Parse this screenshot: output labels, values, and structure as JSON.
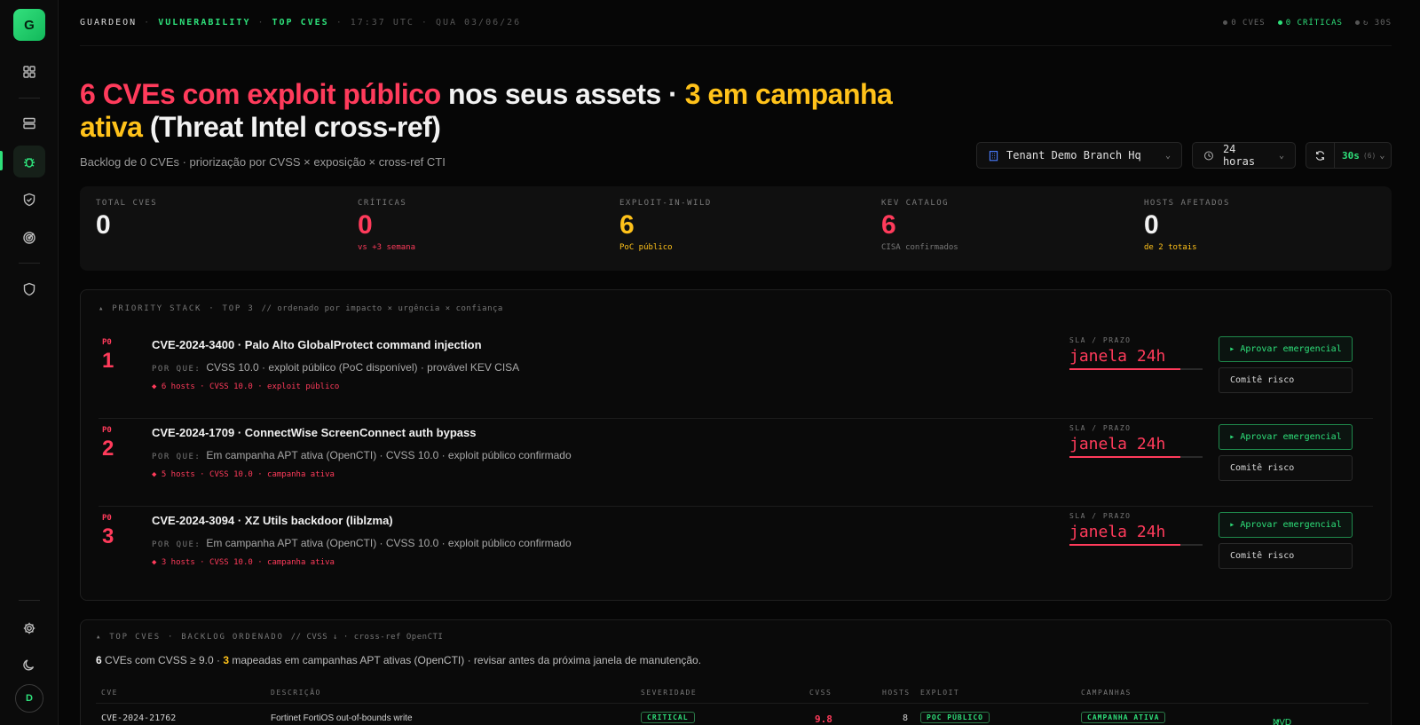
{
  "sidebar": {
    "logo": "G",
    "avatar": "D"
  },
  "topbar": {
    "crumbs": [
      "GUARDEON",
      "VULNERABILITY",
      "TOP CVES",
      "17:37 UTC",
      "QUA 03/06/26"
    ],
    "status": [
      "0 CVES",
      "0 CRÍTICAS",
      "↻ 30S"
    ]
  },
  "header": {
    "headline_red": "6 CVEs com exploit público",
    "headline_mid": " nos seus assets · ",
    "headline_amber": "3 em campanha ativa",
    "headline_end": " (Threat Intel cross-ref)",
    "subline": "Backlog de 0 CVEs · priorização por CVSS × exposição × cross-ref CTI"
  },
  "controls": {
    "tenant": "Tenant Demo Branch Hq",
    "range": "24 horas",
    "refresh": "30s",
    "refresh_count": "(6)"
  },
  "kpis": [
    {
      "label": "TOTAL CVES",
      "value": "0",
      "sub": "",
      "color": "#f2f2f2",
      "sub_color": "#777"
    },
    {
      "label": "CRÍTICAS",
      "value": "0",
      "sub": "vs +3 semana",
      "color": "#ff3b5b",
      "sub_color": "#ff3b5b"
    },
    {
      "label": "EXPLOIT-IN-WILD",
      "value": "6",
      "sub": "PoC público",
      "color": "#ffc21a",
      "sub_color": "#ffc21a"
    },
    {
      "label": "KEV CATALOG",
      "value": "6",
      "sub": "CISA confirmados",
      "color": "#ff3b5b",
      "sub_color": "#777"
    },
    {
      "label": "HOSTS AFETADOS",
      "value": "0",
      "sub": "de 2 totais",
      "color": "#f2f2f2",
      "sub_color": "#ffc21a"
    }
  ],
  "priority": {
    "head": "PRIORITY STACK",
    "top": "TOP 3",
    "comment": "// ordenado por impacto × urgência × confiança",
    "why_label": "POR QUE:",
    "sla_label": "SLA / PRAZO",
    "approve_label": "▸ Aprovar emergencial",
    "committee_label": "Comitê risco",
    "items": [
      {
        "tag": "P0",
        "num": "1",
        "title": "CVE-2024-3400 · Palo Alto GlobalProtect command injection",
        "why": "CVSS 10.0 · exploit público (PoC disponível) · provável KEV CISA",
        "meta": "◆ 6 hosts · CVSS 10.0 · exploit público",
        "sla": "janela 24h",
        "sla_fill": 0.83
      },
      {
        "tag": "P0",
        "num": "2",
        "title": "CVE-2024-1709 · ConnectWise ScreenConnect auth bypass",
        "why": "Em campanha APT ativa (OpenCTI) · CVSS 10.0 · exploit público confirmado",
        "meta": "◆ 5 hosts · CVSS 10.0 · campanha ativa",
        "sla": "janela 24h",
        "sla_fill": 0.83
      },
      {
        "tag": "P0",
        "num": "3",
        "title": "CVE-2024-3094 · XZ Utils backdoor (liblzma)",
        "why": "Em campanha APT ativa (OpenCTI) · CVSS 10.0 · exploit público confirmado",
        "meta": "◆ 3 hosts · CVSS 10.0 · campanha ativa",
        "sla": "janela 24h",
        "sla_fill": 0.83
      }
    ]
  },
  "topcves": {
    "head": "TOP CVES",
    "sub": "BACKLOG ORDENADO",
    "comment": "// CVSS ↓ · cross-ref OpenCTI",
    "summary_n1": "6",
    "summary_t1": " CVEs com CVSS ≥ 9.0 · ",
    "summary_n2": "3",
    "summary_t2": " mapeadas em campanhas APT ativas (OpenCTI) · revisar antes da próxima janela de manutenção.",
    "columns": [
      "CVE",
      "DESCRIÇÃO",
      "SEVERIDADE",
      "CVSS",
      "HOSTS",
      "EXPLOIT",
      "CAMPANHAS"
    ],
    "rows": [
      {
        "cve": "CVE-2024-21762",
        "desc": "Fortinet FortiOS out-of-bounds write",
        "sev": "CRITICAL",
        "cvss": "9.8",
        "hosts": "8",
        "exploit": "POC PÚBLICO",
        "campaign": "CAMPANHA ATIVA",
        "link": "NVD"
      }
    ]
  }
}
